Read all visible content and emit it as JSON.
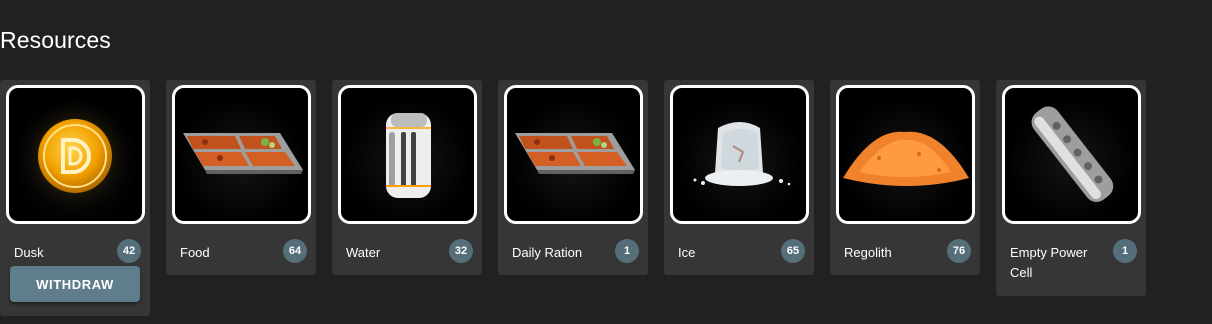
{
  "header": {
    "title": "Resources"
  },
  "colors": {
    "background": "#212121",
    "card": "#363636",
    "badge": "#546e7a",
    "button": "#607d8b",
    "thumb_border": "#ffffff"
  },
  "resources": [
    {
      "name": "Dusk",
      "count": "42",
      "icon": "dusk-coin-icon",
      "action_label": "WITHDRAW"
    },
    {
      "name": "Food",
      "count": "64",
      "icon": "food-tray-icon"
    },
    {
      "name": "Water",
      "count": "32",
      "icon": "water-canister-icon"
    },
    {
      "name": "Daily Ration",
      "count": "1",
      "icon": "ration-tray-icon"
    },
    {
      "name": "Ice",
      "count": "65",
      "icon": "ice-block-icon"
    },
    {
      "name": "Regolith",
      "count": "76",
      "icon": "regolith-pile-icon"
    },
    {
      "name": "Empty Power Cell",
      "count": "1",
      "icon": "power-cell-icon"
    }
  ]
}
